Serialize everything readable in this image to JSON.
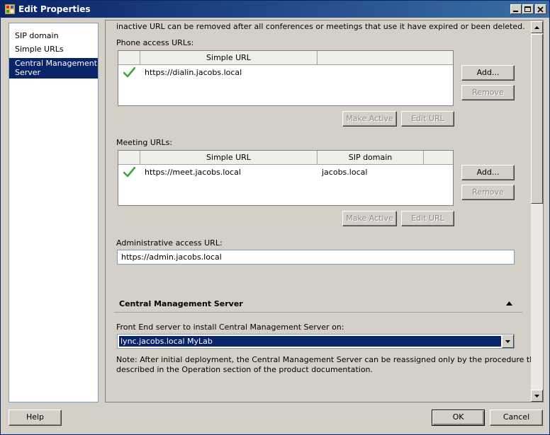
{
  "window": {
    "title": "Edit Properties"
  },
  "sidebar": {
    "items": [
      {
        "label": "SIP domain"
      },
      {
        "label": "Simple URLs"
      },
      {
        "label": "Central Management Server"
      }
    ],
    "selected": "Central Management Server"
  },
  "content": {
    "intro_text": "inactive URL can be removed after all conferences or meetings that use it have expired or been deleted.",
    "phone": {
      "label": "Phone access URLs:",
      "columns": [
        "",
        "Simple URL",
        ""
      ],
      "rows": [
        {
          "active": true,
          "url": "https://dialin.jacobs.local"
        }
      ],
      "add_label": "Add...",
      "remove_label": "Remove",
      "make_active_label": "Make Active",
      "edit_url_label": "Edit URL"
    },
    "meeting": {
      "label": "Meeting URLs:",
      "columns": [
        "",
        "Simple URL",
        "SIP domain",
        ""
      ],
      "rows": [
        {
          "active": true,
          "url": "https://meet.jacobs.local",
          "sip_domain": "jacobs.local"
        }
      ],
      "add_label": "Add...",
      "remove_label": "Remove",
      "make_active_label": "Make Active",
      "edit_url_label": "Edit URL"
    },
    "admin": {
      "label": "Administrative access URL:",
      "value": "https://admin.jacobs.local"
    },
    "cms_section": {
      "title": "Central Management Server",
      "front_end_label": "Front End server to install Central Management Server on:",
      "front_end_value": "lync.jacobs.local   MyLab",
      "note_line1": "Note: After initial deployment, the Central Management Server can be reassigned only by the procedure that is",
      "note_line2": "described in the Operation section of the product documentation."
    }
  },
  "footer": {
    "help_label": "Help",
    "ok_label": "OK",
    "cancel_label": "Cancel"
  },
  "colors": {
    "title_bar": "#0a246a",
    "selection": "#0a246a",
    "check_green": "#3aa83a"
  }
}
